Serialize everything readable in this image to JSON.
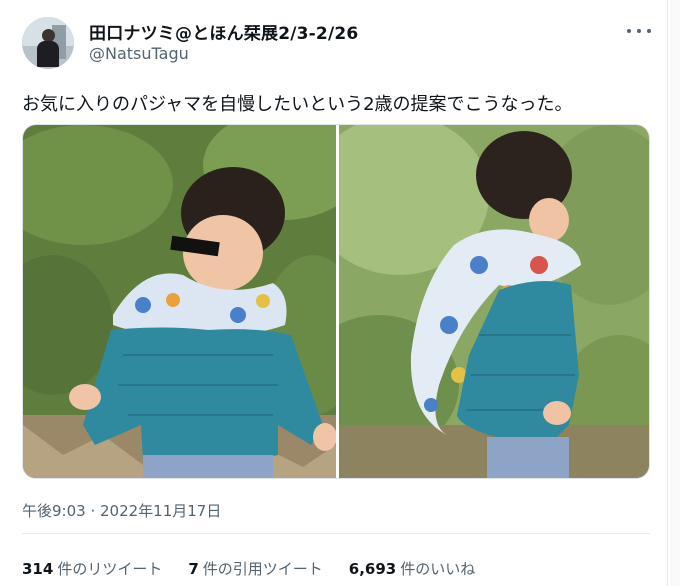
{
  "author": {
    "display_name": "田口ナツミ@とほん栞展2/3-2/26",
    "handle": "@NatsuTagu"
  },
  "tweet": {
    "text": "お気に入りのパジャマを自慢したいという2歳の提案でこうなった。",
    "timestamp": "午後9:03 · 2022年11月17日"
  },
  "stats": [
    {
      "count": "314",
      "label": "件のリツイート"
    },
    {
      "count": "7",
      "label": "件の引用ツイート"
    },
    {
      "count": "6,693",
      "label": "件のいいね"
    }
  ],
  "icons": {
    "more": "more-horizontal-icon"
  },
  "colors": {
    "text_primary": "#0f1419",
    "text_secondary": "#536471",
    "border": "#e6ecf0"
  }
}
